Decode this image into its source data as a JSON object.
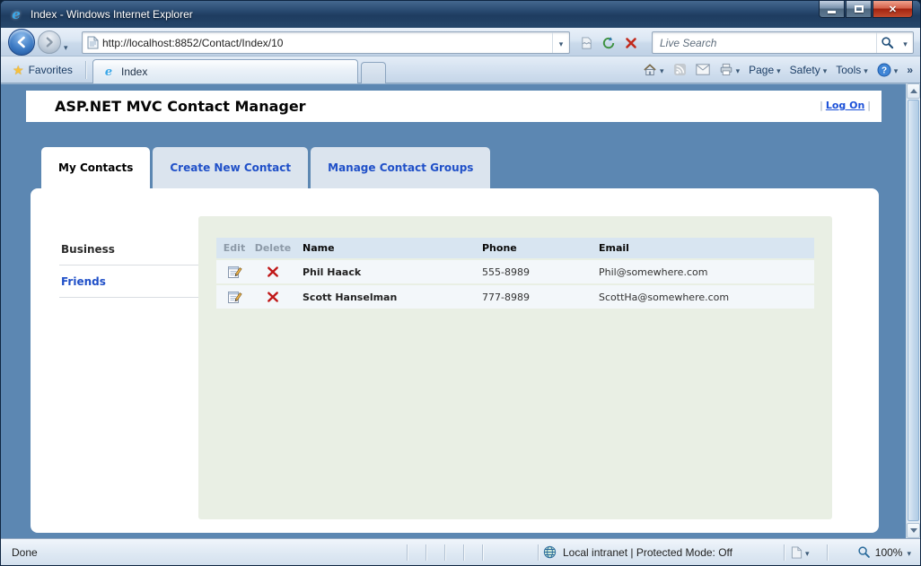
{
  "browser": {
    "window_title": "Index - Windows Internet Explorer",
    "address": {
      "url": "http://localhost:8852/Contact/Index/10"
    },
    "search": {
      "placeholder": "Live Search"
    },
    "favorites_label": "Favorites",
    "tab_title": "Index",
    "command_bar": {
      "page": "Page",
      "safety": "Safety",
      "tools": "Tools"
    },
    "status": {
      "message": "Done",
      "zone": "Local intranet | Protected Mode: Off",
      "zoom": "100%"
    }
  },
  "app": {
    "header": {
      "title": "ASP.NET MVC Contact Manager",
      "logon_label": "Log On"
    },
    "tabs": [
      {
        "label": "My Contacts",
        "active": true
      },
      {
        "label": "Create New Contact",
        "active": false
      },
      {
        "label": "Manage Contact Groups",
        "active": false
      }
    ],
    "groups": [
      {
        "label": "Business",
        "selected": true
      },
      {
        "label": "Friends",
        "selected": false
      }
    ],
    "contacts_table": {
      "headers": [
        "Edit",
        "Delete",
        "Name",
        "Phone",
        "Email"
      ],
      "rows": [
        {
          "name": "Phil Haack",
          "phone": "555-8989",
          "email": "Phil@somewhere.com"
        },
        {
          "name": "Scott Hanselman",
          "phone": "777-8989",
          "email": "ScottHa@somewhere.com"
        }
      ]
    }
  },
  "colors": {
    "page_background": "#5c87b2",
    "tab_link_blue": "#2050c8",
    "table_header_bg": "#d8e5f1",
    "table_row_bg": "#f3f7fa",
    "contacts_panel_bg": "#e9efe4",
    "delete_red": "#c01818"
  }
}
